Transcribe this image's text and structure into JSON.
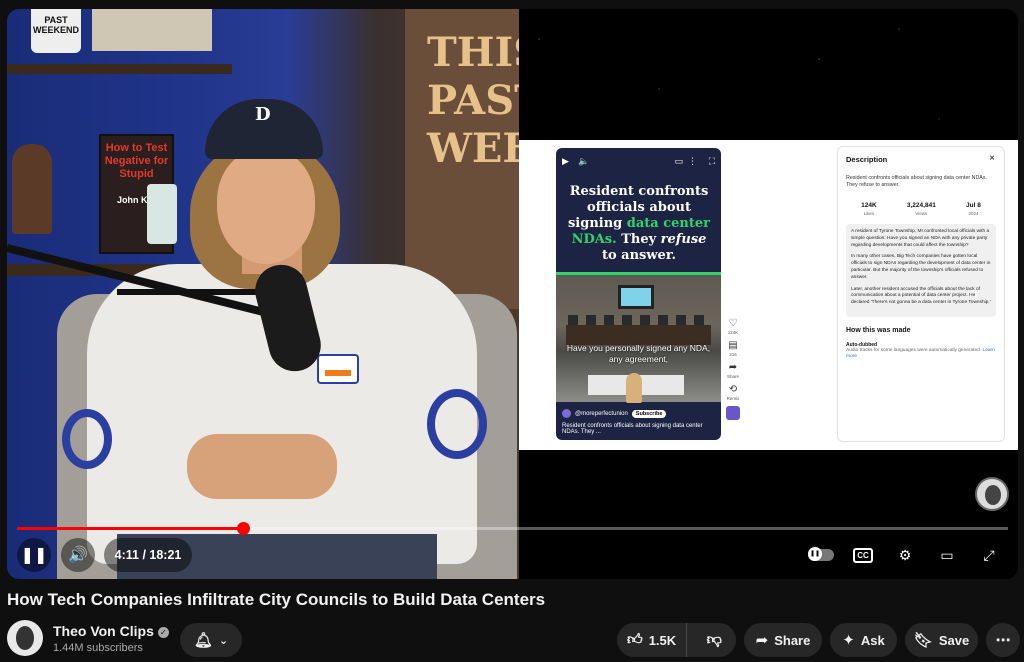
{
  "player": {
    "time_display": "4:11 / 18:21",
    "progress_fraction": 0.228,
    "scene_left": {
      "mug_text": "PAST WEEKEND",
      "book_text": "How to Test Negative for Stupid",
      "book_author": "John Ker",
      "sign_text": "THIS PAST WEEK",
      "cap_logo": "D"
    },
    "embedded_short": {
      "headline_1": "Resident confronts officials about signing",
      "headline_hl": "data center NDAs.",
      "headline_2a": "They ",
      "headline_em": "refuse",
      "headline_2b": " to answer.",
      "caption": "Have you personally signed any NDA, any agreement,",
      "handle": "@moreperfectunion",
      "subscribe": "Subscribe",
      "bottom_text": "Resident confronts officials about signing data center NDAs. They ...",
      "side": {
        "like_count": "124K",
        "comment_count": "216",
        "share": "Share",
        "remix": "Remix"
      }
    },
    "description_panel": {
      "title": "Description",
      "close": "×",
      "summary": "Resident confronts officials about signing data center NDAs. They refuse to answer.",
      "stats": [
        {
          "value": "124K",
          "label": "Likes"
        },
        {
          "value": "3,224,841",
          "label": "Views"
        },
        {
          "value": "Jul 8",
          "label": "2024"
        }
      ],
      "body": [
        "A resident of Tyrone Township, MI confronted local officials with a simple question: Have you signed an NDA with any private party regarding developments that could affect the township?",
        "In many other cases, Big Tech companies have gotten local officials to sign NDAs regarding the development of data center in particular. But the majority of the township's officials refused to answer.",
        "Later, another resident accused the officials about the lack of communication about a potential of data center project. He declared 'There's not gonna be a data center in Tyrone Township.'"
      ],
      "how_made": "How this was made",
      "auto_dubbed_title": "Auto-dubbed",
      "auto_dubbed_desc": "Audio tracks for some languages were automatically generated. ",
      "learn_more": "Learn more"
    },
    "controls": {
      "play_pause_icon": "pause-icon",
      "volume_icon": "volume-icon",
      "cc": "CC"
    }
  },
  "video": {
    "title": "How Tech Companies Infiltrate City Councils to Build Data Centers"
  },
  "channel": {
    "name": "Theo Von Clips",
    "subscribers": "1.44M subscribers",
    "verified_icon": "verified-check-icon"
  },
  "actions": {
    "like_count": "1.5K",
    "share": "Share",
    "ask": "Ask",
    "save": "Save"
  },
  "colors": {
    "background": "#0f0f0f",
    "progress": "#ff0000",
    "pill": "#272727",
    "short_highlight": "#2fd46a"
  }
}
